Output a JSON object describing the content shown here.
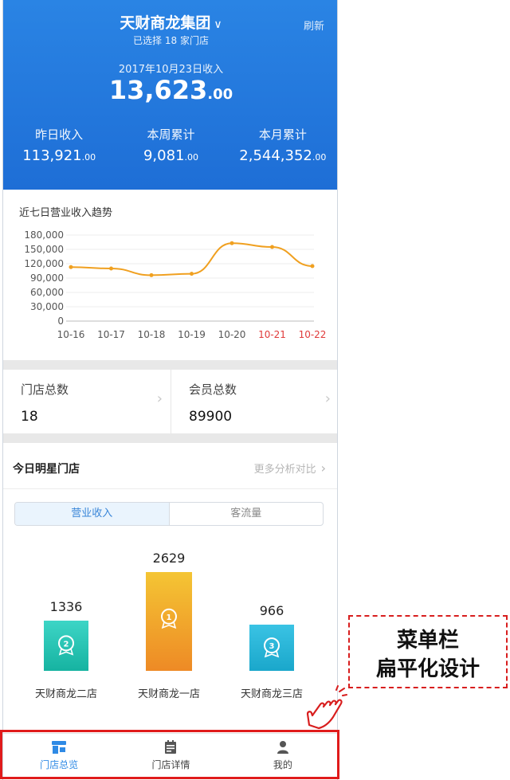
{
  "header": {
    "group_name": "天财商龙集团",
    "selected_stores": "已选择 18 家门店",
    "refresh_label": "刷新",
    "date_label": "2017年10月23日收入",
    "today_income_main": "13,623",
    "today_income_decimal": ".00"
  },
  "stats": [
    {
      "label": "昨日收入",
      "value_main": "113,921",
      "value_decimal": ".00"
    },
    {
      "label": "本周累计",
      "value_main": "9,081",
      "value_decimal": ".00"
    },
    {
      "label": "本月累计",
      "value_main": "2,544,352",
      "value_decimal": ".00"
    }
  ],
  "chart_data": {
    "type": "line",
    "title": "近七日营业收入趋势",
    "categories": [
      "10-16",
      "10-17",
      "10-18",
      "10-19",
      "10-20",
      "10-21",
      "10-22"
    ],
    "highlight_categories": [
      "10-21",
      "10-22"
    ],
    "values": [
      113000,
      110000,
      96000,
      99000,
      163000,
      155000,
      115000
    ],
    "yticks": [
      "0",
      "30,000",
      "60,000",
      "90,000",
      "120,000",
      "150,000",
      "180,000"
    ],
    "ylim": [
      0,
      180000
    ],
    "line_color": "#f0a020",
    "highlight_color": "#e03a3a",
    "grid": true
  },
  "counts": [
    {
      "label": "门店总数",
      "value": "18"
    },
    {
      "label": "会员总数",
      "value": "89900"
    }
  ],
  "star": {
    "title": "今日明星门店",
    "more_label": "更多分析对比",
    "tabs": [
      {
        "label": "营业收入",
        "active": true
      },
      {
        "label": "客流量",
        "active": false
      }
    ],
    "stores": [
      {
        "name": "天财商龙二店",
        "value": 1336,
        "rank": "2",
        "color_top": "#3dd5c6",
        "color_bottom": "#16b3a1"
      },
      {
        "name": "天财商龙一店",
        "value": 2629,
        "rank": "1",
        "color_top": "#f4c534",
        "color_bottom": "#ee8a25"
      },
      {
        "name": "天财商龙三店",
        "value": 966,
        "rank": "3",
        "color_top": "#3ac3e4",
        "color_bottom": "#1aa7cb"
      }
    ]
  },
  "tabbar": [
    {
      "label": "门店总览",
      "icon": "store-overview-icon",
      "active": true
    },
    {
      "label": "门店详情",
      "icon": "store-detail-icon",
      "active": false
    },
    {
      "label": "我的",
      "icon": "user-icon",
      "active": false
    }
  ],
  "annotation": {
    "line1": "菜单栏",
    "line2": "扁平化设计"
  },
  "colors": {
    "brand_blue": "#1e6ed6",
    "tab_active": "#2f8ae5",
    "highlight_red": "#e01b1b"
  }
}
